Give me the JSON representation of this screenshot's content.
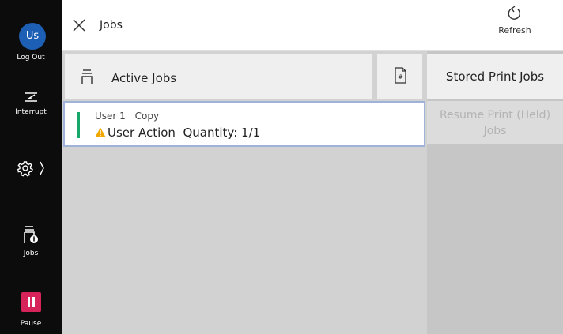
{
  "sidebar": {
    "user_initials": "Us",
    "logout_label": "Log Out",
    "interrupt_label": "Interrupt",
    "jobs_label": "Jobs",
    "pause_label": "Pause"
  },
  "header": {
    "title": "Jobs",
    "refresh_label": "Refresh"
  },
  "tabs": {
    "active_jobs_label": "Active Jobs",
    "stored_print_jobs_label": "Stored Print Jobs",
    "resume_print_label": "Resume Print (Held) Jobs"
  },
  "jobs": [
    {
      "owner": "User 1",
      "type": "Copy",
      "status": "User Action",
      "quantity_label": "Quantity: 1/1"
    }
  ],
  "colors": {
    "accent_blue": "#1d5fb4",
    "pause_red": "#d6245a",
    "job_status_green": "#18a86b",
    "warning_amber": "#f0a800"
  },
  "icons": {
    "close": "close-icon",
    "refresh": "refresh-icon",
    "interrupt": "interrupt-icon",
    "settings": "gear-icon",
    "jobs": "jobs-icon",
    "pause": "pause-icon",
    "document": "document-icon",
    "warning": "warning-icon"
  }
}
